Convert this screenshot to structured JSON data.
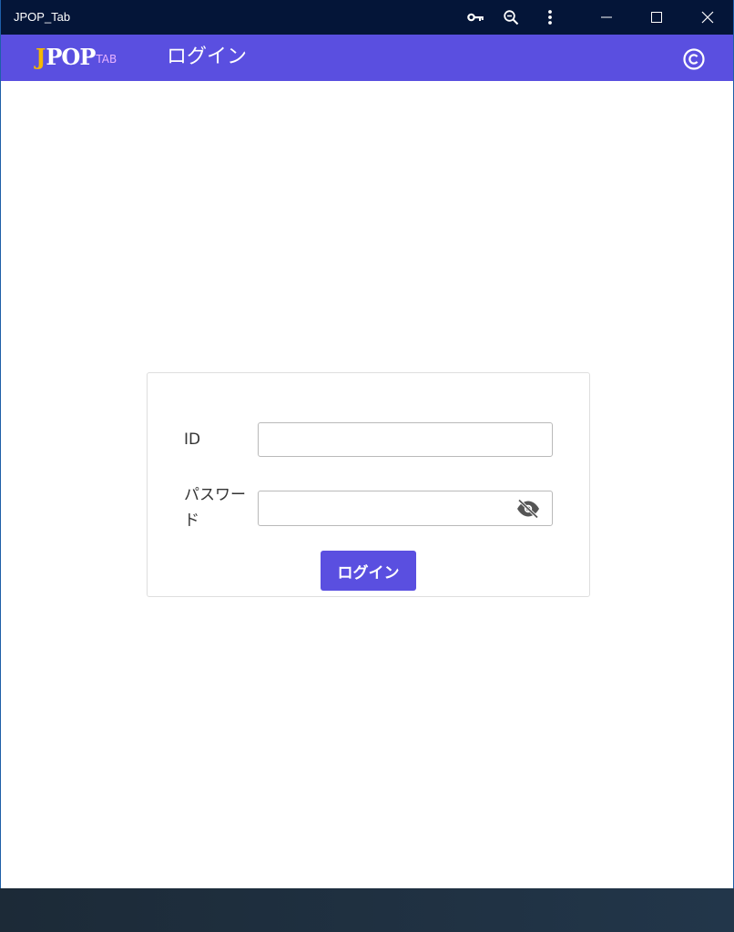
{
  "window": {
    "title": "JPOP_Tab",
    "controls": [
      "key-icon",
      "zoom-out-icon",
      "more-vert-icon",
      "minimize-icon",
      "maximize-icon",
      "close-icon"
    ]
  },
  "appbar": {
    "logo": {
      "j": "J",
      "pop": "POP",
      "tab": "TAB"
    },
    "title": "ログイン",
    "icon": "copyright-icon"
  },
  "login": {
    "id_label": "ID",
    "id_value": "",
    "password_label_line1": "パスワー",
    "password_label_line2": "ド",
    "password_value": "",
    "toggle_icon": "eye-off-icon",
    "submit_label": "ログイン"
  },
  "colors": {
    "titlebar": "#041538",
    "accent": "#5a4fe0",
    "logo_j": "#f5b800",
    "logo_tab": "#e9b3ff"
  }
}
